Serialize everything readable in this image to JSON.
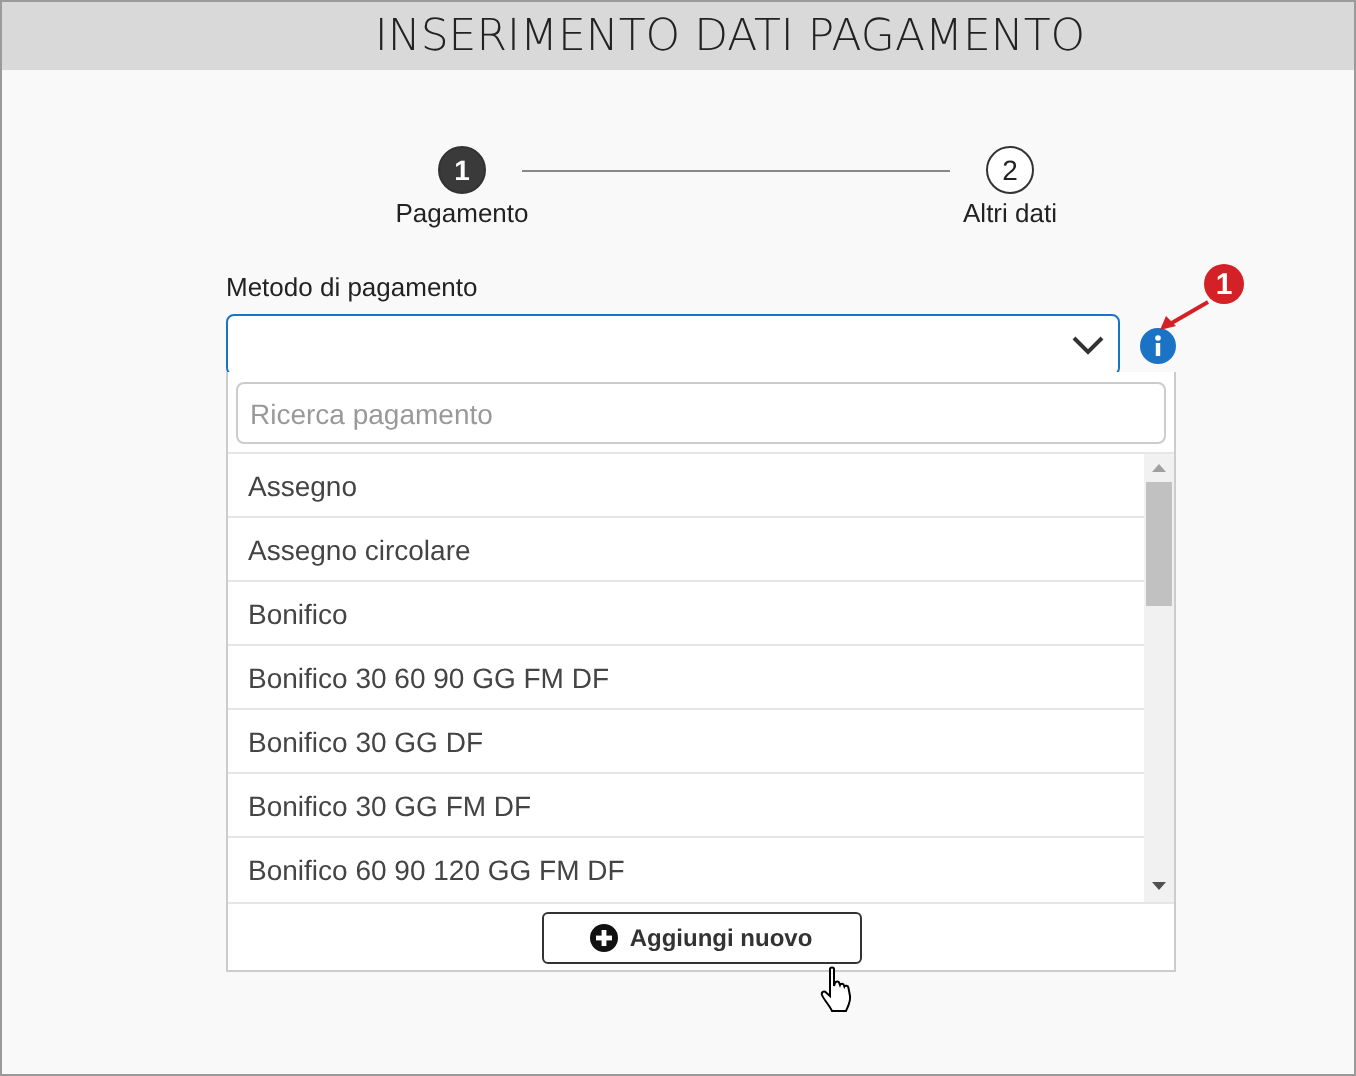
{
  "header": {
    "title": "INSERIMENTO DATI PAGAMENTO"
  },
  "steps": [
    {
      "number": "1",
      "label": "Pagamento",
      "selected": true
    },
    {
      "number": "2",
      "label": "Altri dati",
      "selected": false
    }
  ],
  "field": {
    "label": "Metodo di pagamento"
  },
  "annotation": {
    "text": "1"
  },
  "dropdown": {
    "search": {
      "placeholder": "Ricerca pagamento"
    },
    "options": [
      {
        "label": "Assegno",
        "selected": false
      },
      {
        "label": "Assegno circolare",
        "selected": false
      },
      {
        "label": "Bonifico",
        "selected": false
      },
      {
        "label": "Bonifico 30 60 90 GG FM DF",
        "selected": false
      },
      {
        "label": "Bonifico 30 GG DF",
        "selected": false
      },
      {
        "label": "Bonifico 30 GG FM DF",
        "selected": false
      },
      {
        "label": "Bonifico 60 90 120 GG FM DF",
        "selected": false
      }
    ],
    "add_button": "Aggiungi nuovo"
  }
}
